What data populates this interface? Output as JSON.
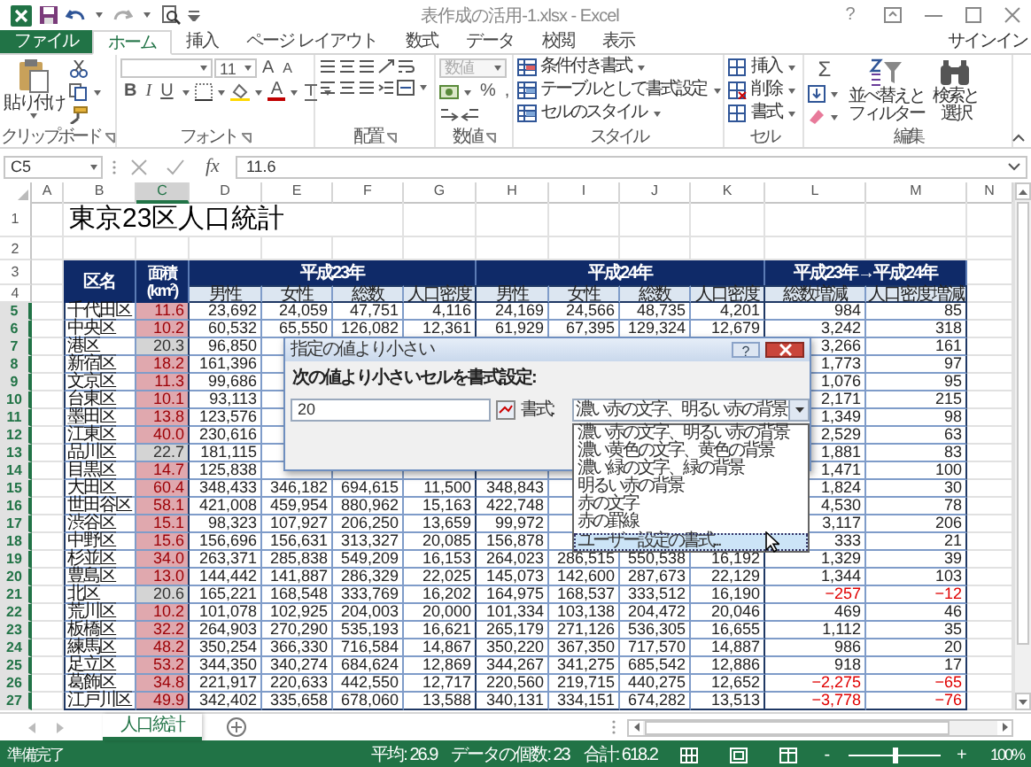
{
  "window": {
    "title": "表作成の活用-1.xlsx - Excel",
    "help": "?"
  },
  "ribbon_tabs": [
    {
      "label": "ファイル",
      "kind": "file",
      "selected": false
    },
    {
      "label": "ホーム",
      "kind": "tab",
      "selected": true
    },
    {
      "label": "挿入",
      "kind": "tab",
      "selected": false
    },
    {
      "label": "ページ レイアウト",
      "kind": "tab",
      "selected": false
    },
    {
      "label": "数式",
      "kind": "tab",
      "selected": false
    },
    {
      "label": "データ",
      "kind": "tab",
      "selected": false
    },
    {
      "label": "校閲",
      "kind": "tab",
      "selected": false
    },
    {
      "label": "表示",
      "kind": "tab",
      "selected": false
    }
  ],
  "sign_in": "サインイン",
  "ribbon": {
    "clipboard": {
      "paste": "貼り付け",
      "group": "クリップボード"
    },
    "font": {
      "size": "11",
      "grow": "A",
      "shrink": "A",
      "bold": "B",
      "italic": "I",
      "underline": "U",
      "font_color": "A",
      "group": "フォント"
    },
    "alignment": {
      "group": "配置"
    },
    "number": {
      "format": "数値",
      "percent": "%",
      "comma": ",",
      "group": "数値"
    },
    "styles": {
      "items": [
        "条件付き書式",
        "テーブルとして書式設定",
        "セルのスタイル"
      ],
      "group": "スタイル"
    },
    "cells": {
      "items": [
        "挿入",
        "削除",
        "書式"
      ],
      "group": "セル"
    },
    "editing": {
      "sum": "Σ",
      "sort": [
        "並べ替えと",
        "フィルター"
      ],
      "find": [
        "検索と",
        "選択"
      ],
      "group": "編集"
    }
  },
  "formula_bar": {
    "name_box": "C5",
    "function_label": "fx",
    "value": "11.6"
  },
  "sheet": {
    "title": "東京23区人口統計",
    "columns": [
      {
        "label": "A",
        "selected": false
      },
      {
        "label": "B",
        "selected": false
      },
      {
        "label": "C",
        "selected": true
      },
      {
        "label": "D",
        "selected": false
      },
      {
        "label": "E",
        "selected": false
      },
      {
        "label": "F",
        "selected": false
      },
      {
        "label": "G",
        "selected": false
      },
      {
        "label": "H",
        "selected": false
      },
      {
        "label": "I",
        "selected": false
      },
      {
        "label": "J",
        "selected": false
      },
      {
        "label": "K",
        "selected": false
      },
      {
        "label": "L",
        "selected": false
      },
      {
        "label": "M",
        "selected": false
      },
      {
        "label": "N",
        "selected": false
      }
    ],
    "top_rows": [
      {
        "number": "1",
        "selected": false
      },
      {
        "number": "2",
        "selected": false
      },
      {
        "number": "3",
        "selected": false
      },
      {
        "number": "4",
        "selected": false
      }
    ],
    "header": {
      "ward": "区名",
      "area": "面積",
      "area_unit": "(km$^{2}$)",
      "years": [
        "平成23年",
        "平成24年"
      ],
      "change": "平成23年→平成24年",
      "subheaders": [
        "男性",
        "女性",
        "総数",
        "人口密度",
        "男性",
        "女性",
        "総数",
        "人口密度",
        "総数増減",
        "人口密度増減"
      ]
    },
    "rows": [
      {
        "number": "5",
        "selected": true,
        "ward": "千代田区",
        "area": "11.6",
        "area_highlight": true,
        "h23": {
          "male": "23,692",
          "female": "24,059",
          "total": "47,751",
          "density": "4,116"
        },
        "h24": {
          "male": "24,169",
          "female": "24,566",
          "total": "48,735",
          "density": "4,201"
        },
        "change": {
          "total": "984",
          "density": "85"
        },
        "decrease": false
      },
      {
        "number": "6",
        "selected": true,
        "ward": "中央区",
        "area": "10.2",
        "area_highlight": true,
        "h23": {
          "male": "60,532",
          "female": "65,550",
          "total": "126,082",
          "density": "12,361"
        },
        "h24": {
          "male": "61,929",
          "female": "67,395",
          "total": "129,324",
          "density": "12,679"
        },
        "change": {
          "total": "3,242",
          "density": "318"
        },
        "decrease": false
      },
      {
        "number": "7",
        "selected": true,
        "ward": "港区",
        "area": "20.3",
        "area_highlight": false,
        "h23": {
          "male": "96,850"
        },
        "h24": {},
        "change": {
          "total": "3,266",
          "density": "161"
        },
        "decrease": false
      },
      {
        "number": "8",
        "selected": true,
        "ward": "新宿区",
        "area": "18.2",
        "area_highlight": true,
        "h23": {
          "male": "161,396"
        },
        "h24": {},
        "change": {
          "total": "1,773",
          "density": "97"
        },
        "decrease": false
      },
      {
        "number": "9",
        "selected": true,
        "ward": "文京区",
        "area": "11.3",
        "area_highlight": true,
        "h23": {
          "male": "99,686"
        },
        "h24": {},
        "change": {
          "total": "1,076",
          "density": "95"
        },
        "decrease": false
      },
      {
        "number": "10",
        "selected": true,
        "ward": "台東区",
        "area": "10.1",
        "area_highlight": true,
        "h23": {
          "male": "93,113"
        },
        "h24": {},
        "change": {
          "total": "2,171",
          "density": "215"
        },
        "decrease": false
      },
      {
        "number": "11",
        "selected": true,
        "ward": "墨田区",
        "area": "13.8",
        "area_highlight": true,
        "h23": {
          "male": "123,576"
        },
        "h24": {},
        "change": {
          "total": "1,349",
          "density": "98"
        },
        "decrease": false
      },
      {
        "number": "12",
        "selected": true,
        "ward": "江東区",
        "area": "40.0",
        "area_highlight": true,
        "h23": {
          "male": "230,616"
        },
        "h24": {},
        "change": {
          "total": "2,529",
          "density": "63"
        },
        "decrease": false
      },
      {
        "number": "13",
        "selected": true,
        "ward": "品川区",
        "area": "22.7",
        "area_highlight": false,
        "h23": {
          "male": "181,115"
        },
        "h24": {},
        "change": {
          "total": "1,881",
          "density": "83"
        },
        "decrease": false
      },
      {
        "number": "14",
        "selected": true,
        "ward": "目黒区",
        "area": "14.7",
        "area_highlight": true,
        "h23": {
          "male": "125,838"
        },
        "h24": {},
        "change": {
          "total": "1,471",
          "density": "100"
        },
        "decrease": false
      },
      {
        "number": "15",
        "selected": true,
        "ward": "大田区",
        "area": "60.4",
        "area_highlight": true,
        "h23": {
          "male": "348,433",
          "female": "346,182",
          "total": "694,615",
          "density": "11,500"
        },
        "h24": {
          "male": "348,843"
        },
        "change": {
          "total": "1,824",
          "density": "30"
        },
        "decrease": false
      },
      {
        "number": "16",
        "selected": true,
        "ward": "世田谷区",
        "area": "58.1",
        "area_highlight": true,
        "h23": {
          "male": "421,008",
          "female": "459,954",
          "total": "880,962",
          "density": "15,163"
        },
        "h24": {
          "male": "422,748"
        },
        "change": {
          "total": "4,530",
          "density": "78"
        },
        "decrease": false
      },
      {
        "number": "17",
        "selected": true,
        "ward": "渋谷区",
        "area": "15.1",
        "area_highlight": true,
        "h23": {
          "male": "98,323",
          "female": "107,927",
          "total": "206,250",
          "density": "13,659"
        },
        "h24": {
          "male": "99,972"
        },
        "change": {
          "total": "3,117",
          "density": "206"
        },
        "decrease": false
      },
      {
        "number": "18",
        "selected": true,
        "ward": "中野区",
        "area": "15.6",
        "area_highlight": true,
        "h23": {
          "male": "156,696",
          "female": "156,631",
          "total": "313,327",
          "density": "20,085"
        },
        "h24": {
          "male": "156,878"
        },
        "change": {
          "total": "333",
          "density": "21"
        },
        "decrease": false
      },
      {
        "number": "19",
        "selected": true,
        "ward": "杉並区",
        "area": "34.0",
        "area_highlight": true,
        "h23": {
          "male": "263,371",
          "female": "285,838",
          "total": "549,209",
          "density": "16,153"
        },
        "h24": {
          "male": "264,023",
          "female": "286,515",
          "total": "550,538",
          "density": "16,192"
        },
        "change": {
          "total": "1,329",
          "density": "39"
        },
        "decrease": false
      },
      {
        "number": "20",
        "selected": true,
        "ward": "豊島区",
        "area": "13.0",
        "area_highlight": true,
        "h23": {
          "male": "144,442",
          "female": "141,887",
          "total": "286,329",
          "density": "22,025"
        },
        "h24": {
          "male": "145,073",
          "female": "142,600",
          "total": "287,673",
          "density": "22,129"
        },
        "change": {
          "total": "1,344",
          "density": "103"
        },
        "decrease": false
      },
      {
        "number": "21",
        "selected": true,
        "ward": "北区",
        "area": "20.6",
        "area_highlight": false,
        "h23": {
          "male": "165,221",
          "female": "168,548",
          "total": "333,769",
          "density": "16,202"
        },
        "h24": {
          "male": "164,975",
          "female": "168,537",
          "total": "333,512",
          "density": "16,190"
        },
        "change": {
          "total": "−257",
          "density": "−12"
        },
        "decrease": true
      },
      {
        "number": "22",
        "selected": true,
        "ward": "荒川区",
        "area": "10.2",
        "area_highlight": true,
        "h23": {
          "male": "101,078",
          "female": "102,925",
          "total": "204,003",
          "density": "20,000"
        },
        "h24": {
          "male": "101,334",
          "female": "103,138",
          "total": "204,472",
          "density": "20,046"
        },
        "change": {
          "total": "469",
          "density": "46"
        },
        "decrease": false
      },
      {
        "number": "23",
        "selected": true,
        "ward": "板橋区",
        "area": "32.2",
        "area_highlight": true,
        "h23": {
          "male": "264,903",
          "female": "270,290",
          "total": "535,193",
          "density": "16,621"
        },
        "h24": {
          "male": "265,179",
          "female": "271,126",
          "total": "536,305",
          "density": "16,655"
        },
        "change": {
          "total": "1,112",
          "density": "35"
        },
        "decrease": false
      },
      {
        "number": "24",
        "selected": true,
        "ward": "練馬区",
        "area": "48.2",
        "area_highlight": true,
        "h23": {
          "male": "350,254",
          "female": "366,330",
          "total": "716,584",
          "density": "14,867"
        },
        "h24": {
          "male": "350,220",
          "female": "367,350",
          "total": "717,570",
          "density": "14,887"
        },
        "change": {
          "total": "986",
          "density": "20"
        },
        "decrease": false
      },
      {
        "number": "25",
        "selected": true,
        "ward": "足立区",
        "area": "53.2",
        "area_highlight": true,
        "h23": {
          "male": "344,350",
          "female": "340,274",
          "total": "684,624",
          "density": "12,869"
        },
        "h24": {
          "male": "344,267",
          "female": "341,275",
          "total": "685,542",
          "density": "12,886"
        },
        "change": {
          "total": "918",
          "density": "17"
        },
        "decrease": false
      },
      {
        "number": "26",
        "selected": true,
        "ward": "葛飾区",
        "area": "34.8",
        "area_highlight": true,
        "h23": {
          "male": "221,917",
          "female": "220,633",
          "total": "442,550",
          "density": "12,717"
        },
        "h24": {
          "male": "220,560",
          "female": "219,715",
          "total": "440,275",
          "density": "12,652"
        },
        "change": {
          "total": "−2,275",
          "density": "−65"
        },
        "decrease": true
      },
      {
        "number": "27",
        "selected": true,
        "ward": "江戸川区",
        "area": "49.9",
        "area_highlight": true,
        "h23": {
          "male": "342,402",
          "female": "335,658",
          "total": "678,060",
          "density": "13,588"
        },
        "h24": {
          "male": "340,131",
          "female": "334,151",
          "total": "674,282",
          "density": "13,513"
        },
        "change": {
          "total": "−3,778",
          "density": "−76"
        },
        "decrease": true
      }
    ]
  },
  "dialog": {
    "title": "指定の値より小さい",
    "help": "?",
    "prompt": "次の値より小さいセルを書式設定:",
    "value": "20",
    "format_label": "書式:",
    "format_value": "濃い赤の文字、明るい赤の背景",
    "options": [
      {
        "label": "濃い赤の文字、明るい赤の背景",
        "selected": false
      },
      {
        "label": "濃い黄色の文字、黄色の背景",
        "selected": false
      },
      {
        "label": "濃い緑の文字、緑の背景",
        "selected": false
      },
      {
        "label": "明るい赤の背景",
        "selected": false
      },
      {
        "label": "赤の文字",
        "selected": false
      },
      {
        "label": "赤の罫線",
        "selected": false
      },
      {
        "label": "ユーザー設定の書式...",
        "selected": true
      }
    ]
  },
  "sheet_tabs": [
    {
      "label": "人口統計",
      "selected": true
    }
  ],
  "status_bar": {
    "ready": "準備完了",
    "average": "平均: 26.9",
    "count": "データの個数: 23",
    "sum": "合計: 618.2",
    "zoom_out": "-",
    "zoom_in": "+",
    "zoom_slider": {
      "level": 0.5
    },
    "zoom": "100%"
  }
}
